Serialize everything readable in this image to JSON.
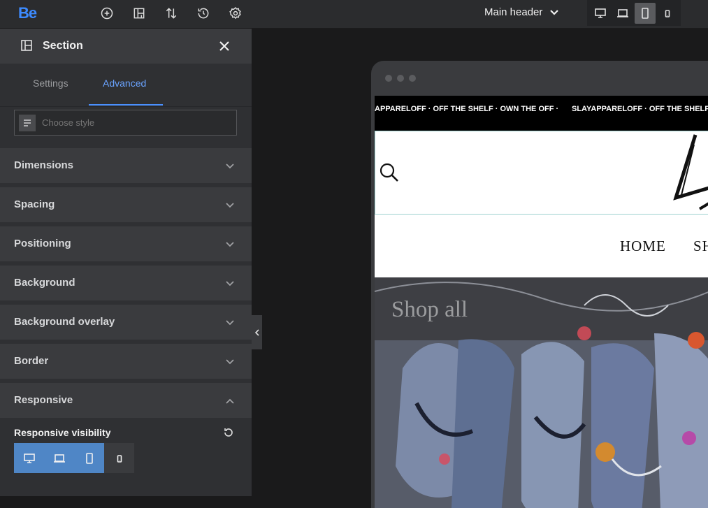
{
  "app": {
    "logo": "Be"
  },
  "topbar": {
    "header_select": "Main header",
    "icons": [
      "add-circle-icon",
      "layout-add-icon",
      "sort-arrows-icon",
      "history-icon",
      "gear-icon"
    ],
    "devices": [
      "desktop-icon",
      "laptop-icon",
      "tablet-icon",
      "mobile-icon"
    ],
    "active_device": "tablet"
  },
  "panel": {
    "title": "Section",
    "tabs": [
      {
        "label": "Settings"
      },
      {
        "label": "Advanced"
      }
    ],
    "active_tab": "Advanced",
    "style_placeholder": "Choose style",
    "sections": [
      {
        "label": "Dimensions",
        "expanded": false
      },
      {
        "label": "Spacing",
        "expanded": false
      },
      {
        "label": "Positioning",
        "expanded": false
      },
      {
        "label": "Background",
        "expanded": false
      },
      {
        "label": "Background overlay",
        "expanded": false
      },
      {
        "label": "Border",
        "expanded": false
      },
      {
        "label": "Responsive",
        "expanded": true
      }
    ],
    "responsive_visibility_label": "Responsive visibility",
    "visibility_toggles": [
      {
        "device": "desktop",
        "visible": true
      },
      {
        "device": "laptop",
        "visible": true
      },
      {
        "device": "tablet",
        "visible": true
      },
      {
        "device": "mobile",
        "visible": false
      }
    ]
  },
  "preview": {
    "ticker_1": "APPARELOFF · OFF THE SHELF · OWN THE OFF ·",
    "ticker_2": "SLAYAPPARELOFF · OFF THE SHELF ·",
    "nav_items": [
      "HOME",
      "SH"
    ],
    "hero_text": "Shop all"
  },
  "colors": {
    "accent": "#4a90ff",
    "logo": "#3d8bff",
    "toggle_on": "#4f86c6"
  }
}
